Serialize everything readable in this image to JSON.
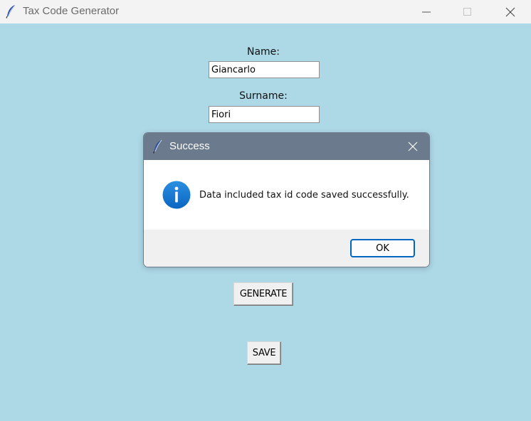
{
  "window": {
    "title": "Tax Code Generator",
    "background_color": "#add8e6"
  },
  "form": {
    "name_label": "Name:",
    "name_value": "Giancarlo",
    "surname_label": "Surname:",
    "surname_value": "Fiori",
    "generate_label": "GENERATE",
    "save_label": "SAVE"
  },
  "dialog": {
    "title": "Success",
    "message": "Data included tax id code saved successfully.",
    "ok_label": "OK",
    "icon": "info-icon",
    "accent_color": "#0067c0"
  }
}
